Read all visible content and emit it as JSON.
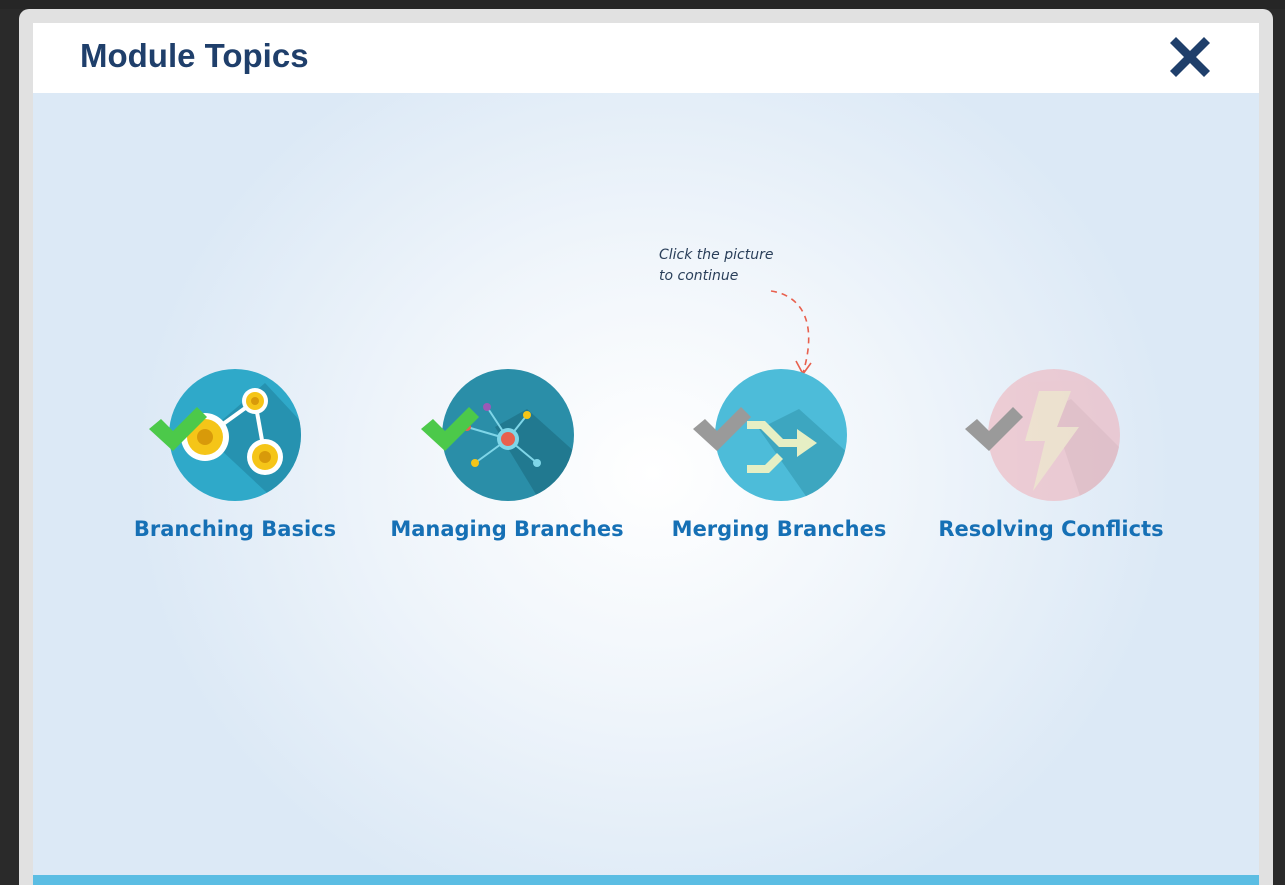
{
  "dialog": {
    "title": "Module Topics",
    "close_icon": "close-x-icon"
  },
  "hint": {
    "line1": "Click the picture",
    "line2": "to continue"
  },
  "topics": [
    {
      "label": "Branching Basics",
      "icon": "branch-nodes-icon",
      "completed": true,
      "circle_color": "#2fa9c9"
    },
    {
      "label": "Managing Branches",
      "icon": "network-icon",
      "completed": true,
      "circle_color": "#2a8ea8"
    },
    {
      "label": "Merging Branches",
      "icon": "merge-arrows-icon",
      "completed": false,
      "circle_color": "#4dbcd9"
    },
    {
      "label": "Resolving Conflicts",
      "icon": "lightning-icon",
      "completed": false,
      "locked": true,
      "circle_color": "#f0a8b0"
    }
  ],
  "colors": {
    "title": "#1f3f6b",
    "label": "#1670b5",
    "check_done": "#4cc94a",
    "check_pending": "#9a9a9a",
    "bottom_bar": "#5bbde3"
  }
}
